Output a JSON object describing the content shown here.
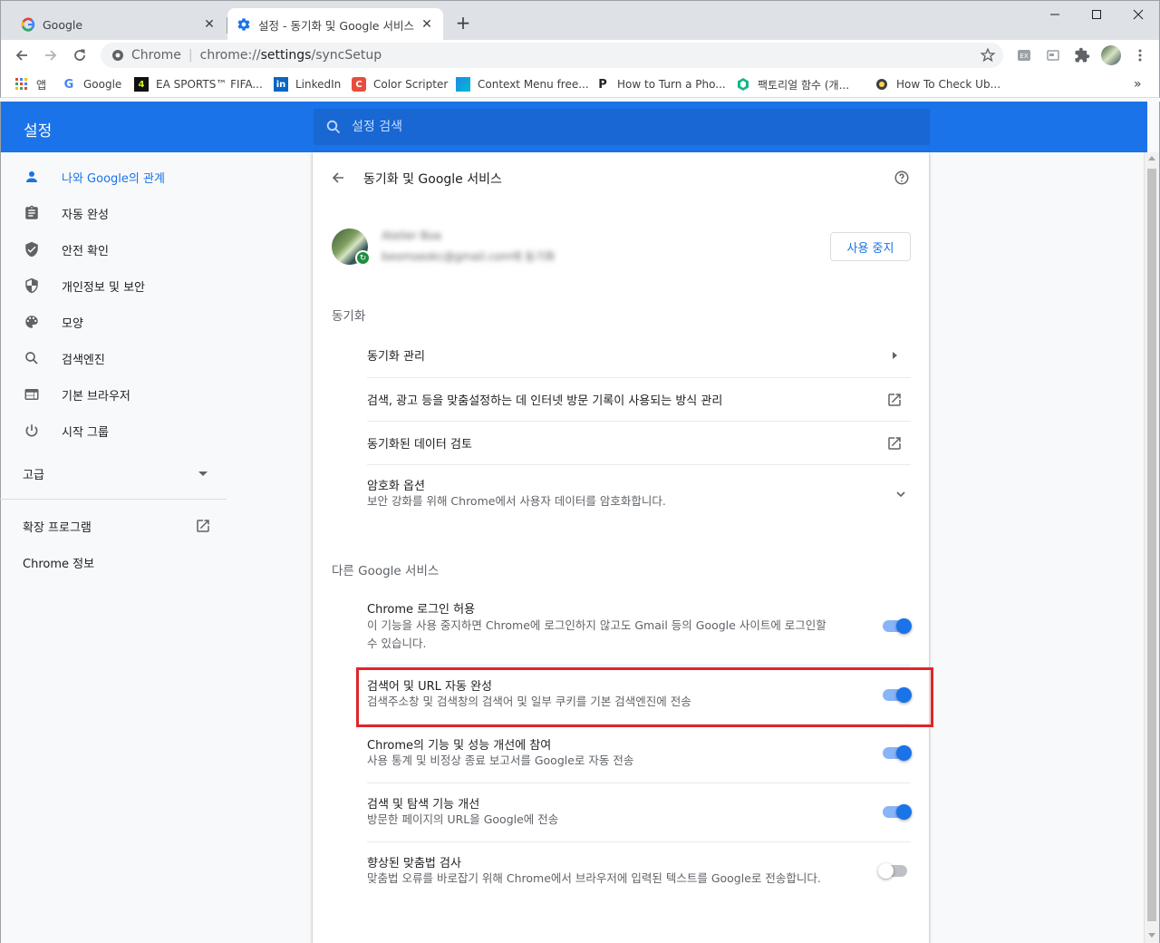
{
  "tabs": [
    {
      "title": "Google",
      "active": false
    },
    {
      "title": "설정 - 동기화 및 Google 서비스",
      "active": true
    }
  ],
  "omnibox": {
    "site": "Chrome",
    "url_prefix": "chrome://",
    "url_host": "settings",
    "url_path": "/syncSetup"
  },
  "bookmarks": [
    {
      "label": "앱",
      "icon": "apps-grid-icon"
    },
    {
      "label": "Google",
      "icon": "google-icon"
    },
    {
      "label": "EA SPORTS™ FIFA...",
      "icon": "ea-icon"
    },
    {
      "label": "LinkedIn",
      "icon": "linkedin-icon"
    },
    {
      "label": "Color Scripter",
      "icon": "color-scripter-icon"
    },
    {
      "label": "Context Menu free...",
      "icon": "context-menu-icon"
    },
    {
      "label": "How to Turn a Pho...",
      "icon": "p-icon"
    },
    {
      "label": "팩토리얼 함수 (개...",
      "icon": "hex-icon"
    },
    {
      "label": "How To Check Ub...",
      "icon": "gear-site-icon"
    }
  ],
  "header": {
    "title": "설정",
    "search_placeholder": "설정 검색"
  },
  "sidebar": {
    "items": [
      {
        "label": "나와 Google의 관계",
        "icon": "person-icon",
        "selected": true
      },
      {
        "label": "자동 완성",
        "icon": "clipboard-icon"
      },
      {
        "label": "안전 확인",
        "icon": "shield-check-icon"
      },
      {
        "label": "개인정보 및 보안",
        "icon": "shield-icon"
      },
      {
        "label": "모양",
        "icon": "palette-icon"
      },
      {
        "label": "검색엔진",
        "icon": "search-icon"
      },
      {
        "label": "기본 브라우저",
        "icon": "browser-icon"
      },
      {
        "label": "시작 그룹",
        "icon": "power-icon"
      }
    ],
    "advanced": "고급",
    "extensions": "확장 프로그램",
    "about": "Chrome 정보"
  },
  "page": {
    "title": "동기화 및 Google 서비스",
    "account": {
      "name": "Atelier Boa",
      "email": "beomseokc@gmail.com에 동기화"
    },
    "stop_button": "사용 중지",
    "sync_section": "동기화",
    "sync_rows": [
      {
        "title": "동기화 관리"
      },
      {
        "title": "검색, 광고 등을 맞춤설정하는 데 인터넷 방문 기록이 사용되는 방식 관리"
      },
      {
        "title": "동기화된 데이터 검토"
      },
      {
        "title": "암호화 옵션",
        "sub": "보안 강화를 위해 Chrome에서 사용자 데이터를 암호화합니다."
      }
    ],
    "other_section": "다른 Google 서비스",
    "other_rows": [
      {
        "title": "Chrome 로그인 허용",
        "sub1": "이 기능을 사용 중지하면 Chrome에 로그인하지 않고도 Gmail 등의 Google 사이트에 로그인할",
        "sub2": "수 있습니다.",
        "on": true
      },
      {
        "title": "검색어 및 URL 자동 완성",
        "sub1": "검색주소창 및 검색창의 검색어 및 일부 쿠키를 기본 검색엔진에 전송",
        "on": true
      },
      {
        "title": "Chrome의 기능 및 성능 개선에 참여",
        "sub1": "사용 통계 및 비정상 종료 보고서를 Google로 자동 전송",
        "on": true
      },
      {
        "title": "검색 및 탐색 기능 개선",
        "sub1": "방문한 페이지의 URL을 Google에 전송",
        "on": true
      },
      {
        "title": "향상된 맞춤법 검사",
        "sub1": "맞춤법 오류를 바로잡기 위해 Chrome에서 브라우저에 입력된 텍스트를 Google로 전송합니다.",
        "on": false
      }
    ]
  },
  "colors": {
    "accent": "#1a73e8",
    "highlight": "#e0252b"
  }
}
